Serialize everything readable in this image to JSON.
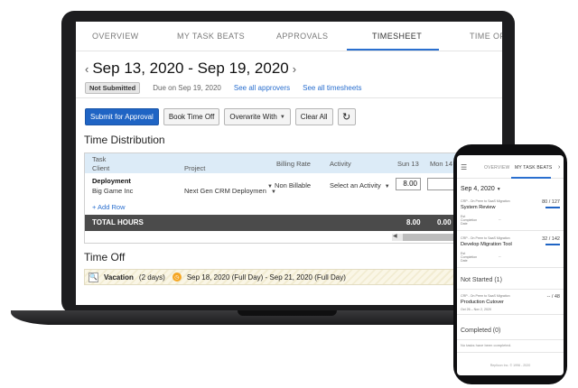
{
  "laptop": {
    "tabs": [
      "OVERVIEW",
      "MY TASK BEATS",
      "APPROVALS",
      "TIMESHEET",
      "TIME OFF"
    ],
    "active_tab": "TIMESHEET",
    "week_range": "Sep 13, 2020 - Sep 19, 2020",
    "status_badge": "Not Submitted",
    "due": "Due on Sep 19, 2020",
    "links": [
      "See all approvers",
      "See all timesheets"
    ],
    "toolbar": {
      "submit": "Submit for Approval",
      "book_time_off": "Book Time Off",
      "overwrite_with": "Overwrite With",
      "clear_all": "Clear All",
      "refresh_icon": "refresh-icon"
    },
    "time_distribution": {
      "title": "Time Distribution",
      "headers": {
        "task": "Task",
        "client": "Client",
        "project": "Project",
        "billing_rate": "Billing Rate",
        "activity": "Activity",
        "sun": "Sun 13",
        "mon": "Mon 14"
      },
      "row": {
        "task": "Deployment",
        "client": "Big Game Inc",
        "project": "Next Gen CRM Deploymen",
        "billing_rate": "Non Billable",
        "activity": "Select an Activity",
        "sun_hours": "8.00"
      },
      "add_row": "+ Add Row",
      "total_label": "TOTAL HOURS",
      "total_sun": "8.00",
      "total_mon": "0.00"
    },
    "time_off": {
      "title": "Time Off",
      "type": "Vacation",
      "days": "(2 days)",
      "range": "Sep 18, 2020 (Full Day) - Sep 21, 2020 (Full Day)"
    }
  },
  "phone": {
    "tabs": [
      "OVERVIEW",
      "MY TASK BEATS"
    ],
    "date": "Sep 4, 2020",
    "cards": [
      {
        "path": "CRP - On Prem to SaaS Migration",
        "name": "System Review",
        "count": "80 / 127",
        "est_label": "Est Completion Date",
        "est_value": "--"
      },
      {
        "path": "CRP - On Prem to SaaS Migration",
        "name": "Develop Migration Tool",
        "count": "32 / 142",
        "est_label": "Est Completion Date",
        "est_value": "--"
      }
    ],
    "not_started": {
      "title": "Not Started (1)",
      "card": {
        "path": "CRP - On Prem to SaaS Migration",
        "name": "Production Cutover",
        "count": "-- / 48",
        "dates": "Oct 26 – Nov 2, 2020"
      }
    },
    "completed": {
      "title": "Completed (0)",
      "empty": "No tasks have been completed."
    },
    "footer": "Replicon Inc. © 1996 - 2020"
  }
}
